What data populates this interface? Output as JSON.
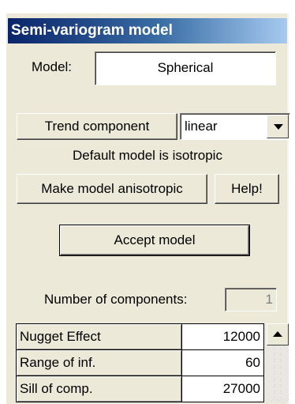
{
  "panel": {
    "title": "Semi-variogram model",
    "model_label": "Model:",
    "model_value": "Spherical",
    "trend_button": "Trend component",
    "trend_value": "linear",
    "default_text": "Default model is isotropic",
    "anisotropic_button": "Make model anisotropic",
    "help_button": "Help!",
    "accept_button": "Accept model",
    "components_label": "Number of components:",
    "components_value": "1",
    "parameters": [
      {
        "name": "Nugget Effect",
        "value": "12000"
      },
      {
        "name": "Range of inf.",
        "value": "60"
      },
      {
        "name": "Sill of comp.",
        "value": "27000"
      }
    ]
  },
  "icons": {
    "dropdown": "chevron-down-icon",
    "scroll_up": "scroll-up-arrow-icon"
  },
  "colors": {
    "title_start": "#0a246a",
    "title_end": "#a6caf0",
    "panel_bg": "#ece9d8"
  }
}
